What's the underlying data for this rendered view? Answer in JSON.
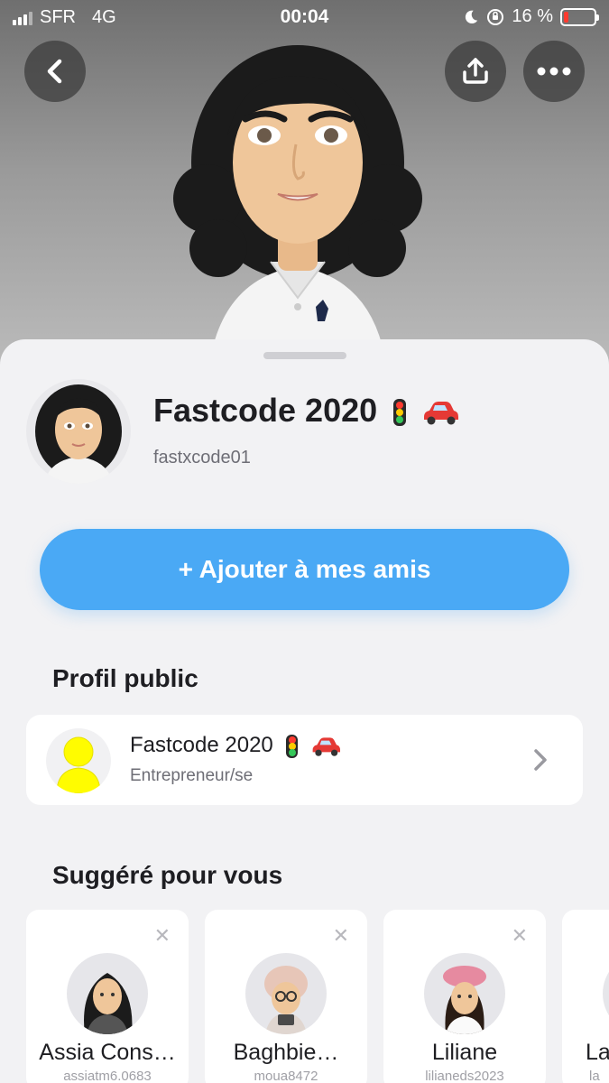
{
  "status_bar": {
    "carrier": "SFR",
    "network": "4G",
    "time": "00:04",
    "battery": "16 %"
  },
  "profile": {
    "display_name": "Fastcode 2020",
    "username": "fastxcode01",
    "add_button_label": "+ Ajouter à mes amis"
  },
  "public_profile": {
    "section_title": "Profil public",
    "name": "Fastcode 2020",
    "category": "Entrepreneur/se"
  },
  "suggestions": {
    "section_title": "Suggéré pour vous",
    "items": [
      {
        "name": "Assia Cons…",
        "username": "assiatm6.0683"
      },
      {
        "name": "Baghbie…",
        "username": "moua8472"
      },
      {
        "name": "Liliane",
        "username": "lilianeds2023"
      },
      {
        "name": "La",
        "username": "la"
      }
    ]
  },
  "colors": {
    "accent": "#4aa9f5",
    "battery_low": "#ff3b30",
    "ghost_yellow": "#fffc00"
  },
  "icons": [
    "back-icon",
    "share-icon",
    "more-icon",
    "chevron-right-icon",
    "close-icon",
    "traffic-light-emoji",
    "car-emoji",
    "ghost-avatar-icon"
  ]
}
